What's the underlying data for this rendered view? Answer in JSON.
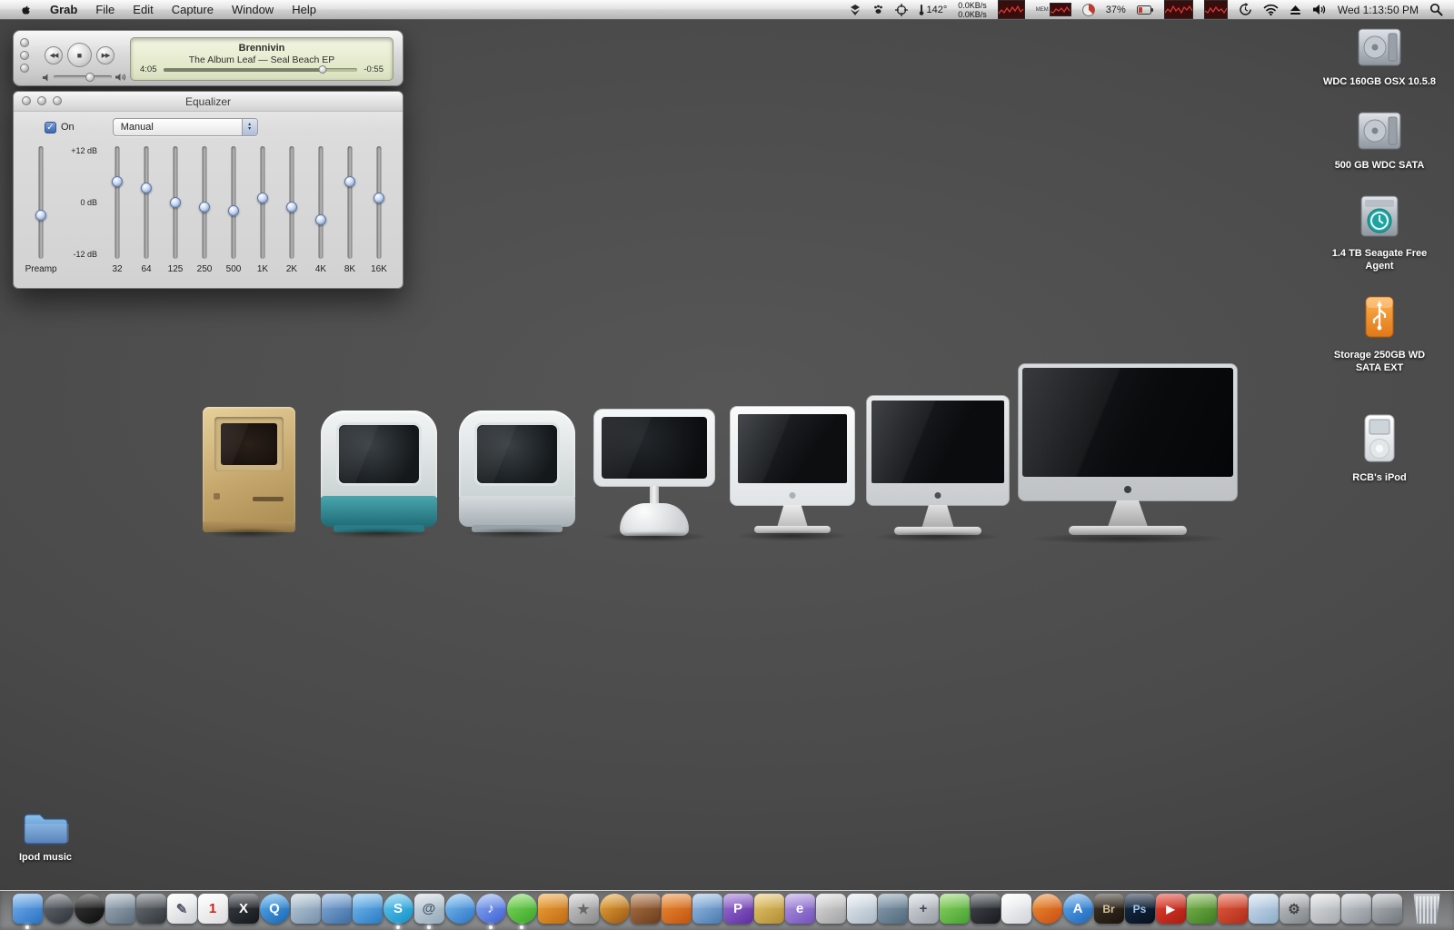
{
  "menu_bar": {
    "app_name": "Grab",
    "menus": [
      "File",
      "Edit",
      "Capture",
      "Window",
      "Help"
    ],
    "status": {
      "temperature": "142°",
      "net_up": "0.0KB/s",
      "net_down": "0.0KB/s",
      "mem_label": "MEM",
      "disk_pct": "37%",
      "clock": "Wed 1:13:50 PM"
    }
  },
  "player": {
    "track_title": "Brennivin",
    "track_info": "The Album Leaf — Seal Beach EP",
    "elapsed": "4:05",
    "remaining": "-0:55",
    "progress_pct": 82,
    "volume_pct": 62,
    "prev_glyph": "◀◀",
    "stop_glyph": "■",
    "next_glyph": "▶▶"
  },
  "equalizer": {
    "title": "Equalizer",
    "on_label": "On",
    "on_checked": true,
    "check_glyph": "✓",
    "preset": "Manual",
    "scale": {
      "top": "+12 dB",
      "mid": "0 dB",
      "bottom": "-12 dB"
    },
    "range": 12,
    "preamp": {
      "label": "Preamp",
      "value": -3
    },
    "bands": [
      {
        "label": "32",
        "value": 5
      },
      {
        "label": "64",
        "value": 3.5
      },
      {
        "label": "125",
        "value": 0
      },
      {
        "label": "250",
        "value": -1
      },
      {
        "label": "500",
        "value": -2
      },
      {
        "label": "1K",
        "value": 1
      },
      {
        "label": "2K",
        "value": -1
      },
      {
        "label": "4K",
        "value": -4
      },
      {
        "label": "8K",
        "value": 5
      },
      {
        "label": "16K",
        "value": 1
      }
    ]
  },
  "desktop": {
    "drive_icons": [
      {
        "label": "WDC 160GB OSX 10.5.8",
        "type": "internal"
      },
      {
        "label": "500 GB WDC SATA",
        "type": "internal"
      },
      {
        "label": "1.4 TB Seagate Free Agent",
        "type": "timemachine"
      },
      {
        "label": "Storage 250GB WD SATA EXT",
        "type": "usb"
      },
      {
        "label": "RCB's iPod",
        "type": "ipod",
        "gap": true
      }
    ],
    "folder_label": "Ipod music",
    "wallpaper_macs": [
      "macintosh-classic",
      "imac-g3-teal",
      "imac-g3-white",
      "imac-g4",
      "imac-white",
      "imac-aluminum",
      "imac-unibody-27"
    ]
  },
  "dock": {
    "icons": [
      {
        "n": "finder",
        "a": "#79b5f0",
        "b": "#2a70c2",
        "run": true
      },
      {
        "n": "app-dark-circle",
        "a": "#6b7077",
        "b": "#2e3238",
        "s": "c"
      },
      {
        "n": "vinyl-app",
        "a": "#3c3c3c",
        "b": "#0c0c0c",
        "s": "c"
      },
      {
        "n": "remote-desktop",
        "a": "#a8b4c0",
        "b": "#5c6c7c"
      },
      {
        "n": "photo-booth",
        "a": "#70757c",
        "b": "#30353a"
      },
      {
        "n": "textedit",
        "a": "#ffffff",
        "b": "#cdd1d5",
        "g": "✎",
        "gc": "#556"
      },
      {
        "n": "ical",
        "a": "#fdfdfd",
        "b": "#dedede",
        "g": "1",
        "gc": "#cc2222"
      },
      {
        "n": "x11",
        "a": "#3c4148",
        "b": "#14181c",
        "g": "X",
        "gc": "#ffffff"
      },
      {
        "n": "quicktime",
        "a": "#5cb2f2",
        "b": "#1864b2",
        "s": "c",
        "g": "Q",
        "gc": "#ffffff"
      },
      {
        "n": "preview",
        "a": "#c2d0dc",
        "b": "#7490aa"
      },
      {
        "n": "transmission",
        "a": "#8cb2de",
        "b": "#3c6ca2"
      },
      {
        "n": "ichat",
        "a": "#7cc4f4",
        "b": "#2a78c2"
      },
      {
        "n": "skype",
        "a": "#6cc8f0",
        "b": "#1090c8",
        "s": "c",
        "g": "S",
        "gc": "#ffffff",
        "run": true
      },
      {
        "n": "mail",
        "a": "#d4dde4",
        "b": "#93a7b8",
        "g": "@",
        "gc": "#455a6a",
        "run": true
      },
      {
        "n": "safari",
        "a": "#84c4f4",
        "b": "#2a72c4",
        "s": "c"
      },
      {
        "n": "itunes",
        "a": "#92b4f2",
        "b": "#3c5cd2",
        "s": "c",
        "g": "♪",
        "gc": "#ffffff",
        "run": true
      },
      {
        "n": "spotify",
        "a": "#84dc60",
        "b": "#38a428",
        "s": "c",
        "run": true
      },
      {
        "n": "vlc",
        "a": "#f0a83c",
        "b": "#c06a14"
      },
      {
        "n": "star-app",
        "a": "#cfcfcf",
        "b": "#8a8a8a",
        "g": "★",
        "gc": "#666"
      },
      {
        "n": "audacity",
        "a": "#f0b040",
        "b": "#9a5410",
        "s": "c"
      },
      {
        "n": "garageband",
        "a": "#b47848",
        "b": "#6a3c1c"
      },
      {
        "n": "blender",
        "a": "#f09038",
        "b": "#c05410"
      },
      {
        "n": "word-app",
        "a": "#a0c4e8",
        "b": "#4878b0"
      },
      {
        "n": "parallels",
        "a": "#a078d8",
        "b": "#5c2ca0",
        "g": "P",
        "gc": "#ffffff"
      },
      {
        "n": "gold-app",
        "a": "#e8cc70",
        "b": "#b08c34"
      },
      {
        "n": "emule",
        "a": "#b89ce4",
        "b": "#7050bc",
        "g": "e",
        "gc": "#ffffff"
      },
      {
        "n": "ink-app",
        "a": "#e0e0e0",
        "b": "#a0a0a0"
      },
      {
        "n": "chart-app",
        "a": "#e8eef4",
        "b": "#aab8c4"
      },
      {
        "n": "tool-app",
        "a": "#90a4b4",
        "b": "#50687c"
      },
      {
        "n": "calculator",
        "a": "#d8dce0",
        "b": "#989ea6",
        "g": "+",
        "gc": "#445"
      },
      {
        "n": "green-app",
        "a": "#94d868",
        "b": "#44a030"
      },
      {
        "n": "dark-utility",
        "a": "#4a4f55",
        "b": "#16191d"
      },
      {
        "n": "white-doc",
        "a": "#ffffff",
        "b": "#d0d4d8"
      },
      {
        "n": "firefox",
        "a": "#f09438",
        "b": "#c84c10",
        "s": "c"
      },
      {
        "n": "app-store",
        "a": "#64acee",
        "b": "#1c66ba",
        "s": "c",
        "g": "A",
        "gc": "#ffffff"
      },
      {
        "n": "bridge",
        "a": "#40362a",
        "b": "#1c140c",
        "g": "Br",
        "gc": "#d8c49a",
        "sm": true
      },
      {
        "n": "photoshop",
        "a": "#1a2f4a",
        "b": "#06101e",
        "g": "Ps",
        "gc": "#9cc8f0",
        "sm": true
      },
      {
        "n": "youtube",
        "a": "#e84434",
        "b": "#a81c10",
        "g": "▶",
        "gc": "#ffffff",
        "sm": true
      },
      {
        "n": "dino-app",
        "a": "#84bc54",
        "b": "#3c7c20"
      },
      {
        "n": "red-app",
        "a": "#e86044",
        "b": "#b02c18"
      },
      {
        "n": "blue-doc",
        "a": "#d4e2f0",
        "b": "#8cacc8"
      },
      {
        "n": "system-preferences",
        "a": "#c4c8cc",
        "b": "#7e8388",
        "g": "⚙",
        "gc": "#444"
      },
      {
        "n": "stacks",
        "a": "#e0e2e4",
        "b": "#a6aaae"
      },
      {
        "n": "drive-app",
        "a": "#cdd1d5",
        "b": "#8a9096"
      },
      {
        "n": "utility2",
        "a": "#b8bcc0",
        "b": "#70767c"
      },
      {
        "n": "trash",
        "trash": true
      }
    ]
  }
}
